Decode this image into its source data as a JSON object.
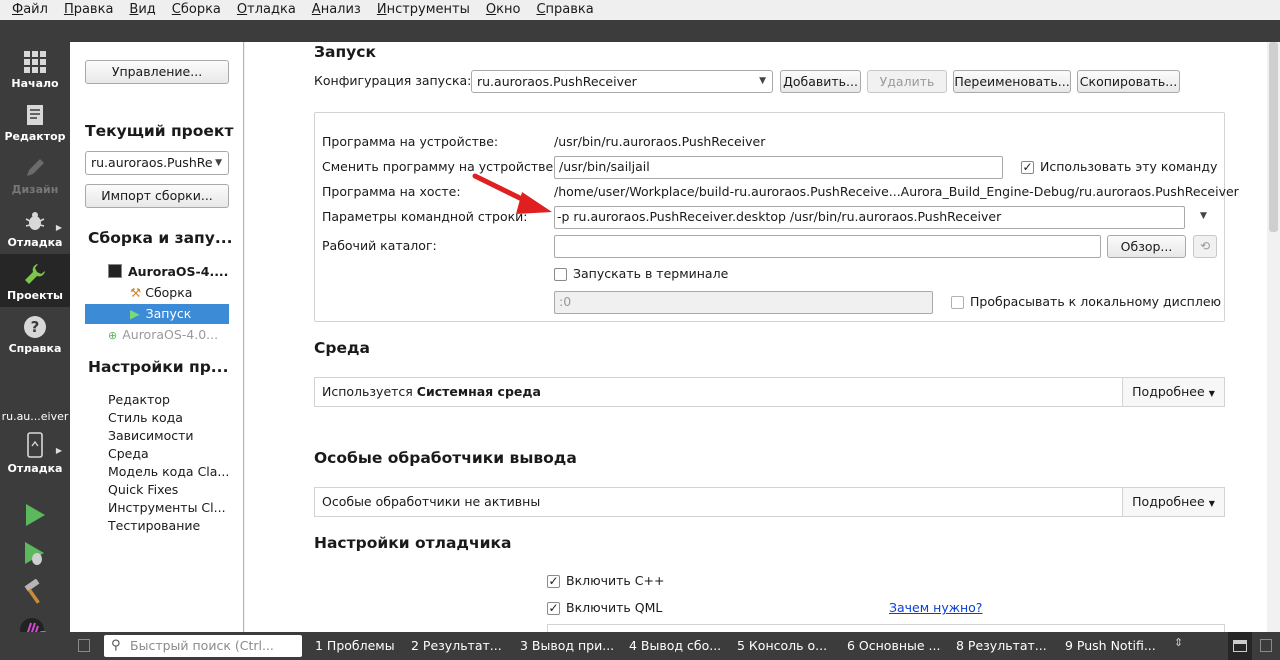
{
  "menubar": [
    {
      "u": "Ф",
      "rest": "айл"
    },
    {
      "u": "П",
      "rest": "равка"
    },
    {
      "u": "В",
      "rest": "ид"
    },
    {
      "u": "С",
      "rest": "борка"
    },
    {
      "u": "О",
      "rest": "тладка"
    },
    {
      "u": "А",
      "rest": "нализ"
    },
    {
      "u": "И",
      "rest": "нструменты"
    },
    {
      "u": "О",
      "rest": "кно"
    },
    {
      "u": "С",
      "rest": "правка"
    }
  ],
  "modebar": {
    "items": [
      {
        "label": "Начало",
        "icon": "grid-icon"
      },
      {
        "label": "Редактор",
        "icon": "document-icon"
      },
      {
        "label": "Дизайн",
        "icon": "pen-icon"
      },
      {
        "label": "Отладка",
        "icon": "bug-icon"
      },
      {
        "label": "Проекты",
        "icon": "wrench-icon"
      },
      {
        "label": "Справка",
        "icon": "help-icon"
      }
    ],
    "kit_label": "ru.au...eiver",
    "kit_mode_label": "Отладка"
  },
  "nav": {
    "manage_button": "Управление...",
    "current_project_title": "Текущий проект",
    "current_project_value": "ru.auroraos.PushRe",
    "import_button": "Импорт сборки...",
    "build_run_title": "Сборка и запу...",
    "kit_name": "AuroraOS-4....",
    "build_item": "Сборка",
    "run_item": "Запуск",
    "kit_inactive": "AuroraOS-4.0...",
    "project_settings_title": "Настройки пр...",
    "settings_items": [
      "Редактор",
      "Стиль кода",
      "Зависимости",
      "Среда",
      "Модель кода Cla...",
      "Quick Fixes",
      "Инструменты Cl...",
      "Тестирование"
    ]
  },
  "run": {
    "title": "Запуск",
    "config_label": "Конфигурация запуска:",
    "config_value": "ru.auroraos.PushReceiver",
    "add_button": "Добавить...",
    "remove_button": "Удалить",
    "rename_button": "Переименовать...",
    "copy_button": "Скопировать...",
    "device_program_label": "Программа на устройстве:",
    "device_program_value": "/usr/bin/ru.auroraos.PushReceiver",
    "alt_program_label": "Сменить программу на устройстве:",
    "alt_program_value": "/usr/bin/sailjail",
    "use_command_label": "Использовать эту команду",
    "host_program_label": "Программа на хосте:",
    "host_program_value": "/home/user/Workplace/build-ru.auroraos.PushReceive...Aurora_Build_Engine-Debug/ru.auroraos.PushReceiver",
    "args_label": "Параметры командной строки:",
    "args_value": "-p ru.auroraos.PushReceiver.desktop /usr/bin/ru.auroraos.PushReceiver",
    "workdir_label": "Рабочий каталог:",
    "workdir_value": "",
    "browse_button": "Обзор...",
    "run_in_terminal_label": "Запускать в терминале",
    "display_value": ":0",
    "forward_display_label": "Пробрасывать к локальному дисплею"
  },
  "environment": {
    "title": "Среда",
    "prefix": "Используется ",
    "bold": "Системная среда",
    "details": "Подробнее"
  },
  "output_handlers": {
    "title": "Особые обработчики вывода",
    "text": "Особые обработчики не активны",
    "details": "Подробнее"
  },
  "debugger": {
    "title": "Настройки отладчика",
    "enable_cpp": "Включить C++",
    "enable_qml": "Включить QML",
    "why_link": "Зачем нужно?"
  },
  "statusbar": {
    "search_placeholder": "Быстрый поиск (Ctrl...",
    "tabs": [
      "1  Проблемы",
      "2  Результат...",
      "3  Вывод при...",
      "4  Вывод сбо...",
      "5  Консоль о...",
      "6  Основные ...",
      "8  Результат...",
      "9  Push Notifi..."
    ]
  },
  "colors": {
    "modebar_bg": "#3c3c3c",
    "selection": "#3b8bd6",
    "run_green": "#5cb85c",
    "arrow_red": "#e02020",
    "link_blue": "#0a3fd6"
  }
}
